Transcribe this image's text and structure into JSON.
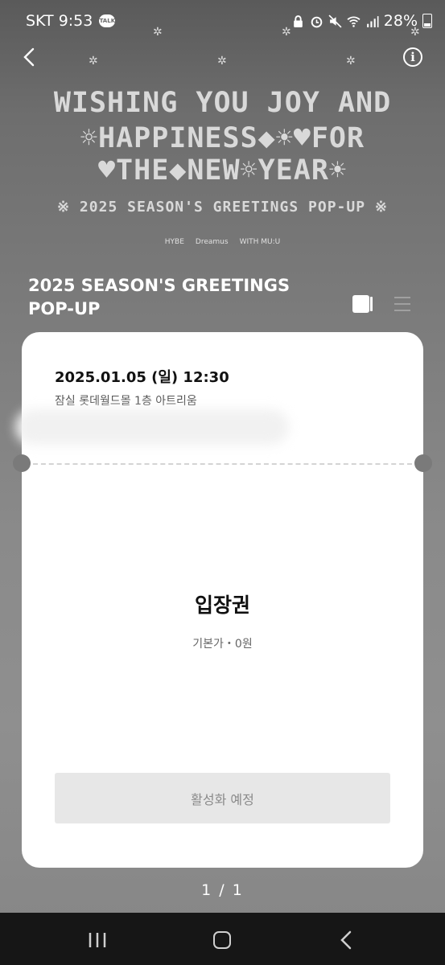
{
  "status_bar": {
    "carrier_time": "SKT 9:53",
    "talk_badge": "TALK",
    "battery": "28%"
  },
  "banner": {
    "line1": "WISHING YOU JOY AND",
    "line2": "☼HAPPINESS◆☀♥FOR",
    "line3": "♥THE◆NEW☼YEAR☀",
    "line4": "※ 2025 SEASON'S GREETINGS POP-UP ※",
    "logos": [
      "HYBE",
      "Dreamus",
      "WITH MU:U"
    ]
  },
  "event": {
    "title": "2025 SEASON'S GREETINGS POP-UP"
  },
  "ticket": {
    "datetime": "2025.01.05 (일) 12:30",
    "venue": "잠실 롯데월드몰 1층 아트리움",
    "name": "입장권",
    "price": "기본가・0원",
    "button": "활성화 예정"
  },
  "pagination": "1 / 1",
  "icons": {
    "back": "back-arrow-icon",
    "info": "info-icon",
    "calendar": "calendar-icon",
    "menu": "menu-icon"
  },
  "colors": {
    "background": "#7d7d7d",
    "card": "#ffffff",
    "button": "#e7e7e7",
    "navbar": "#161616"
  }
}
